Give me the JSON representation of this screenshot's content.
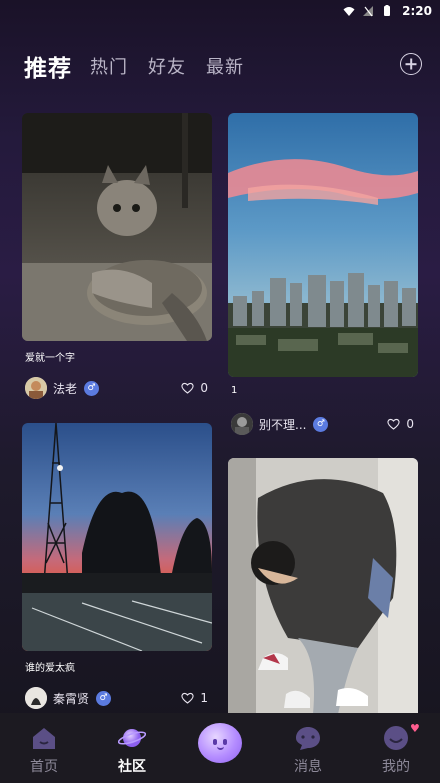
{
  "status_bar": {
    "time": "2:20"
  },
  "tabs": [
    {
      "label": "推荐",
      "active": true
    },
    {
      "label": "热门",
      "active": false
    },
    {
      "label": "好友",
      "active": false
    },
    {
      "label": "最新",
      "active": false
    }
  ],
  "posts": [
    {
      "caption": "爱就一个字",
      "author": "法老",
      "gender": "♂",
      "likes": "0",
      "image": "gray-tabby-kitten"
    },
    {
      "caption": "1",
      "author": "别不理...",
      "gender": "♂",
      "likes": "0",
      "image": "city-skyline-pink-clouds"
    },
    {
      "caption": "谁的爱太疯",
      "author": "秦霄贤",
      "gender": "♂",
      "likes": "1",
      "image": "sunset-power-tower-parking-lot"
    },
    {
      "caption": "",
      "author": "",
      "gender": "",
      "likes": "",
      "image": "person-bending-over-sneakers"
    }
  ],
  "bottom_nav": [
    {
      "label": "首页",
      "icon": "home-icon",
      "active": false
    },
    {
      "label": "社区",
      "icon": "planet-icon",
      "active": true
    },
    {
      "label": "",
      "icon": "ghost-bubble-icon",
      "active": false
    },
    {
      "label": "消息",
      "icon": "message-icon",
      "active": false
    },
    {
      "label": "我的",
      "icon": "profile-icon",
      "active": false
    }
  ],
  "colors": {
    "accent": "#9b6bff",
    "gender_male": "#5b7be0"
  }
}
